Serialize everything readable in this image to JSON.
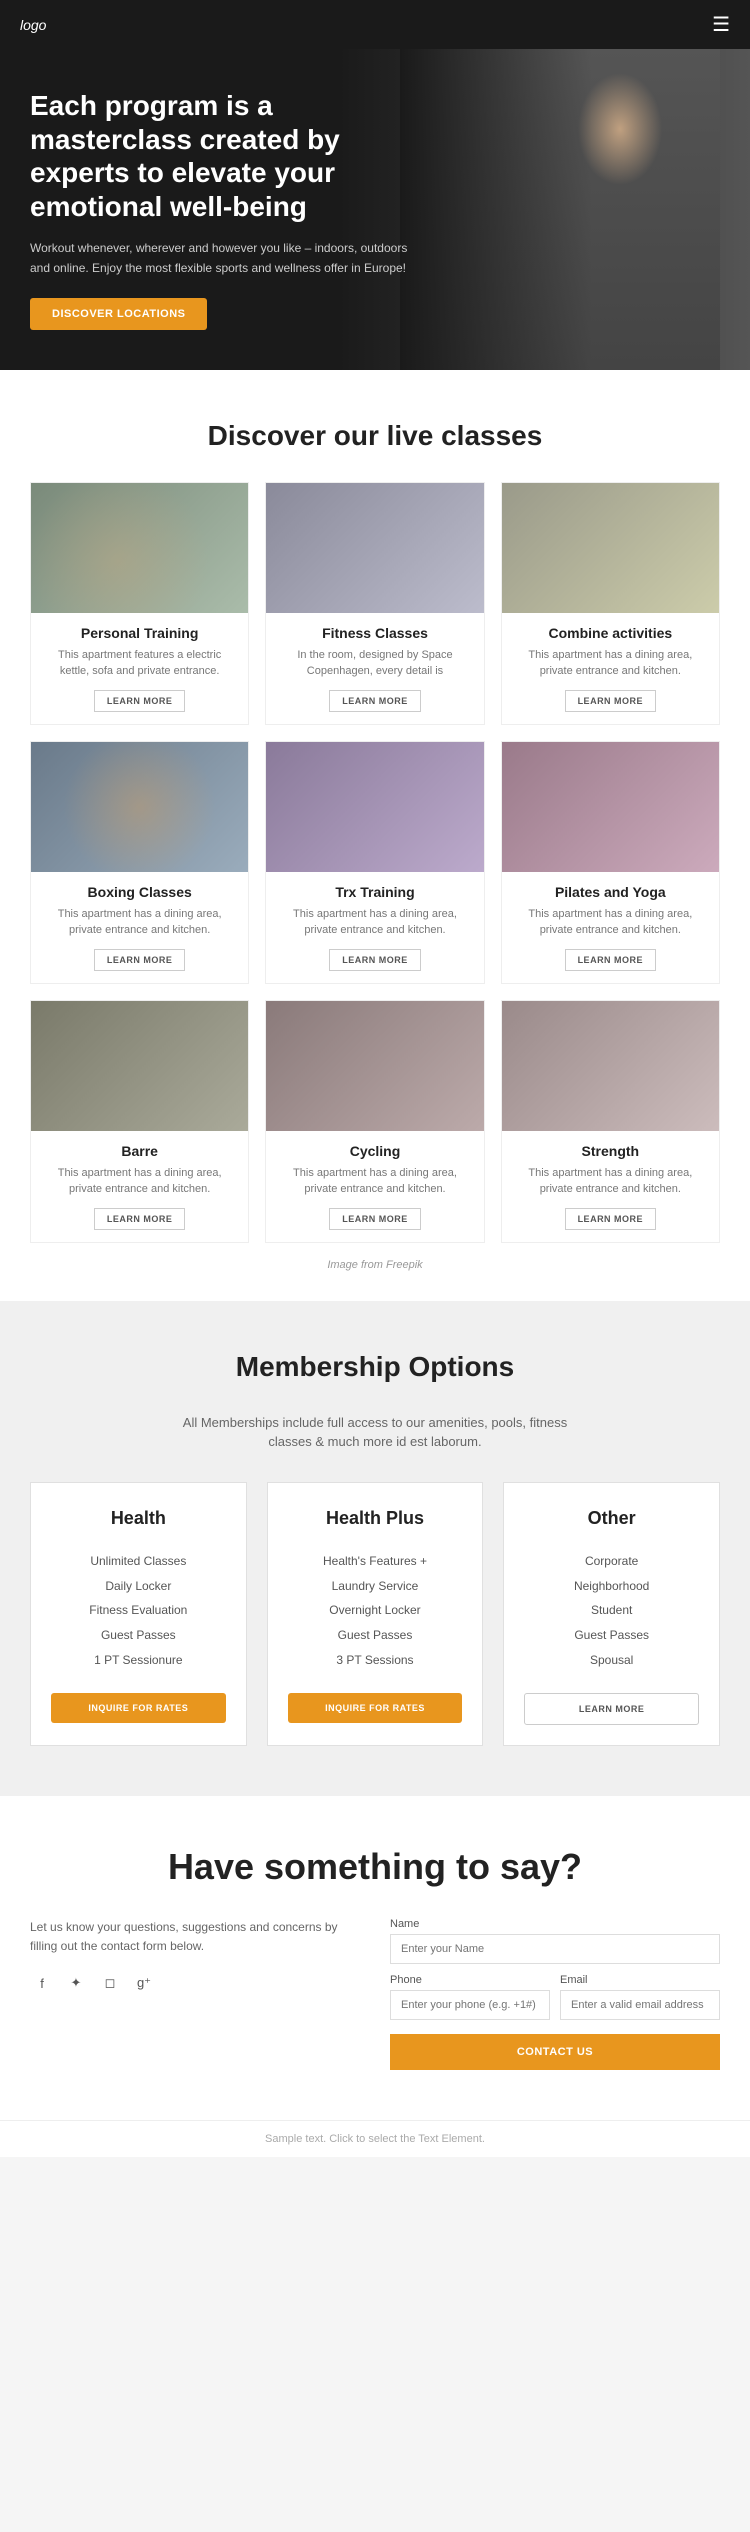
{
  "header": {
    "logo": "logo",
    "menu_icon": "☰"
  },
  "hero": {
    "title": "Each program is a masterclass created by experts to elevate your emotional well-being",
    "subtitle": "Workout whenever, wherever and however you like – indoors, outdoors and online. Enjoy the most flexible sports and wellness offer in Europe!",
    "button_label": "DISCOVER LOCATIONS"
  },
  "live_classes": {
    "section_title": "Discover our live classes",
    "cards": [
      {
        "title": "Personal Training",
        "desc": "This apartment features a electric kettle, sofa and private entrance.",
        "btn": "LEARN MORE",
        "img_class": "img-personal"
      },
      {
        "title": "Fitness Classes",
        "desc": "In the room, designed by Space Copenhagen, every detail is",
        "btn": "LEARN MORE",
        "img_class": "img-fitness"
      },
      {
        "title": "Combine activities",
        "desc": "This apartment has a dining area, private entrance and kitchen.",
        "btn": "LEARN MORE",
        "img_class": "img-combine"
      },
      {
        "title": "Boxing Classes",
        "desc": "This apartment has a dining area, private entrance and kitchen.",
        "btn": "LEARN MORE",
        "img_class": "img-boxing"
      },
      {
        "title": "Trx Training",
        "desc": "This apartment has a dining area, private entrance and kitchen.",
        "btn": "LEARN MORE",
        "img_class": "img-trx"
      },
      {
        "title": "Pilates and Yoga",
        "desc": "This apartment has a dining area, private entrance and kitchen.",
        "btn": "LEARN MORE",
        "img_class": "img-pilates"
      },
      {
        "title": "Barre",
        "desc": "This apartment has a dining area, private entrance and kitchen.",
        "btn": "LEARN MORE",
        "img_class": "img-barre"
      },
      {
        "title": "Cycling",
        "desc": "This apartment has a dining area, private entrance and kitchen.",
        "btn": "LEARN MORE",
        "img_class": "img-cycling"
      },
      {
        "title": "Strength",
        "desc": "This apartment has a dining area, private entrance and kitchen.",
        "btn": "LEARN MORE",
        "img_class": "img-strength"
      }
    ],
    "freepik_note": "Image from Freepik"
  },
  "membership": {
    "section_title": "Membership Options",
    "subtitle": "All Memberships include full access to our amenities, pools, fitness classes & much more id est laborum.",
    "plans": [
      {
        "title": "Health",
        "features": [
          "Unlimited Classes",
          "Daily Locker",
          "Fitness Evaluation",
          "Guest Passes",
          "1 PT Sessionure"
        ],
        "btn_label": "INQUIRE FOR RATES",
        "btn_type": "filled"
      },
      {
        "title": "Health Plus",
        "features": [
          "Health's Features +",
          "Laundry Service",
          "Overnight Locker",
          "Guest Passes",
          "3 PT Sessions"
        ],
        "btn_label": "INQUIRE FOR RATES",
        "btn_type": "filled"
      },
      {
        "title": "Other",
        "features": [
          "Corporate",
          "Neighborhood",
          "Student",
          "Guest Passes",
          "Spousal"
        ],
        "btn_label": "LEARN MORE",
        "btn_type": "outline"
      }
    ]
  },
  "contact": {
    "section_title": "Have something to say?",
    "desc": "Let us know your questions, suggestions and concerns by filling out the contact form below.",
    "social_icons": [
      "f",
      "t",
      "in",
      "g+"
    ],
    "form": {
      "name_label": "Name",
      "name_placeholder": "Enter your Name",
      "phone_label": "Phone",
      "phone_placeholder": "Enter your phone (e.g. +1#)",
      "email_label": "Email",
      "email_placeholder": "Enter a valid email address",
      "submit_label": "CONTACT US"
    }
  },
  "footer": {
    "note": "Sample text. Click to select the Text Element."
  }
}
